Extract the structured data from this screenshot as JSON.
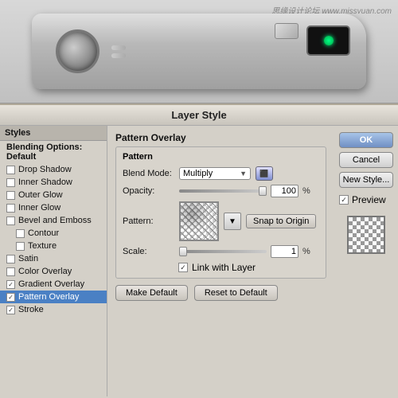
{
  "watermark": "思缘设计论坛 www.missvuan.com",
  "dialog": {
    "title": "Layer Style",
    "styles_header": "Styles",
    "blending_options": "Blending Options: Default",
    "style_items": [
      {
        "id": "drop-shadow",
        "label": "Drop Shadow",
        "checked": false,
        "indent": false
      },
      {
        "id": "inner-shadow",
        "label": "Inner Shadow",
        "checked": false,
        "indent": false
      },
      {
        "id": "outer-glow",
        "label": "Outer Glow",
        "checked": false,
        "indent": false
      },
      {
        "id": "inner-glow",
        "label": "Inner Glow",
        "checked": false,
        "indent": false
      },
      {
        "id": "bevel-emboss",
        "label": "Bevel and Emboss",
        "checked": false,
        "indent": false
      },
      {
        "id": "contour",
        "label": "Contour",
        "checked": false,
        "indent": true
      },
      {
        "id": "texture",
        "label": "Texture",
        "checked": false,
        "indent": true
      },
      {
        "id": "satin",
        "label": "Satin",
        "checked": false,
        "indent": false
      },
      {
        "id": "color-overlay",
        "label": "Color Overlay",
        "checked": false,
        "indent": false
      },
      {
        "id": "gradient-overlay",
        "label": "Gradient Overlay",
        "checked": true,
        "indent": false
      },
      {
        "id": "pattern-overlay",
        "label": "Pattern Overlay",
        "checked": true,
        "indent": false,
        "selected": true
      },
      {
        "id": "stroke",
        "label": "Stroke",
        "checked": true,
        "indent": false
      }
    ],
    "section_title": "Pattern Overlay",
    "subsection_title": "Pattern",
    "blend_mode_label": "Blend Mode:",
    "blend_mode_value": "Multiply",
    "opacity_label": "Opacity:",
    "opacity_value": "100",
    "opacity_unit": "%",
    "pattern_label": "Pattern:",
    "snap_origin_label": "Snap to Origin",
    "scale_label": "Scale:",
    "scale_value": "1",
    "scale_unit": "%",
    "link_layer_label": "Link with Layer",
    "link_layer_checked": true,
    "make_default": "Make Default",
    "reset_to_default": "Reset to Default",
    "ok_label": "OK",
    "cancel_label": "Cancel",
    "new_style_label": "New Style...",
    "preview_label": "Preview",
    "preview_checked": true
  }
}
